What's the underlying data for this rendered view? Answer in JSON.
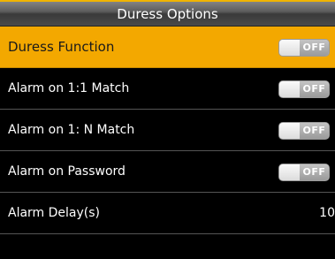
{
  "title": "Duress Options",
  "rows": [
    {
      "label": "Duress Function",
      "state": "OFF",
      "selected": true
    },
    {
      "label": "Alarm on 1:1 Match",
      "state": "OFF"
    },
    {
      "label": "Alarm on 1: N Match",
      "state": "OFF"
    },
    {
      "label": "Alarm on Password",
      "state": "OFF"
    },
    {
      "label": "Alarm Delay(s)",
      "value": "10"
    }
  ],
  "colors": {
    "selected_row": "#f3a800",
    "background": "#000000",
    "title_bar": "#5c5c5c"
  }
}
